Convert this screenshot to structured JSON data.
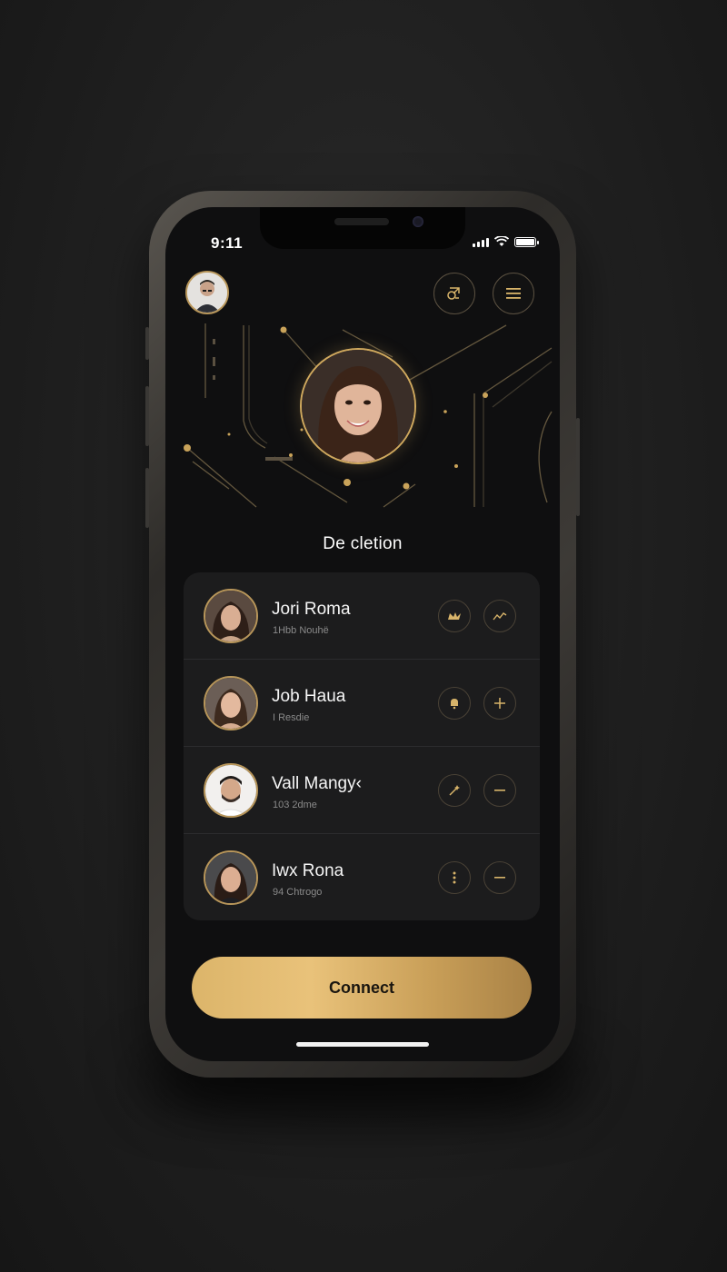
{
  "status_bar": {
    "time": "9:11",
    "battery_level": 1.0
  },
  "header": {
    "profile_avatar_icon": "person-avatar",
    "left_button_icon": "share-icon",
    "right_button_icon": "menu-icon"
  },
  "hero": {
    "portrait_icon": "woman-portrait"
  },
  "section": {
    "title": "De cletion"
  },
  "contacts": [
    {
      "name": "Jori Roma",
      "subtitle": "1Hbb Nouhë",
      "action1_icon": "crown-icon",
      "action2_icon": "trend-icon"
    },
    {
      "name": "Job Haua",
      "subtitle": "I Resdie",
      "action1_icon": "bell-icon",
      "action2_icon": "plus-icon"
    },
    {
      "name": "Vall Mangy‹",
      "subtitle": "103 2dme",
      "action1_icon": "wand-icon",
      "action2_icon": "minus-icon"
    },
    {
      "name": "Iwx Rona",
      "subtitle": "94 Chtrogo",
      "action1_icon": "more-icon",
      "action2_icon": "minus-icon"
    }
  ],
  "cta": {
    "label": "Connect"
  },
  "colors": {
    "accent": "#d8b46a",
    "background": "#0f0f10",
    "card": "#1c1c1d"
  }
}
